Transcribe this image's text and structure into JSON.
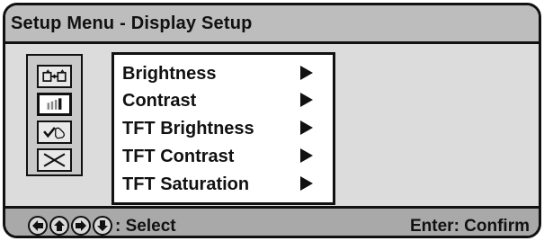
{
  "header": {
    "title": "Setup Menu - Display Setup"
  },
  "icons": [
    {
      "name": "display-input-icon",
      "selected": false
    },
    {
      "name": "level-bars-icon",
      "selected": true
    },
    {
      "name": "check-hand-icon",
      "selected": false
    },
    {
      "name": "close-icon",
      "selected": false
    }
  ],
  "menu": {
    "items": [
      {
        "label": "Brightness",
        "icon": "triangle-right-icon"
      },
      {
        "label": "Contrast",
        "icon": "triangle-right-icon"
      },
      {
        "label": "TFT Brightness",
        "icon": "triangle-right-icon"
      },
      {
        "label": "TFT Contrast",
        "icon": "triangle-right-icon"
      },
      {
        "label": "TFT Saturation",
        "icon": "triangle-right-icon"
      }
    ]
  },
  "footer": {
    "nav_icons": [
      "arrow-left-icon",
      "arrow-up-icon",
      "arrow-right-icon",
      "arrow-down-icon"
    ],
    "select_label": ": Select",
    "confirm_label": "Enter: Confirm"
  },
  "colors": {
    "title_bar": "#bdbdbd",
    "panel": "#dcdcdc",
    "footer": "#a9a9a9",
    "menu_background": "#ffffff",
    "text": "#111111"
  }
}
